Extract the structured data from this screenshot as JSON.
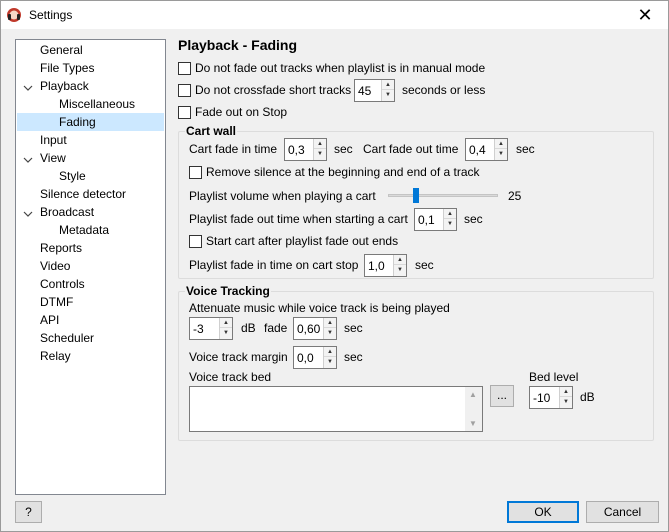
{
  "window": {
    "title": "Settings",
    "close_glyph": "✕"
  },
  "icons": {
    "app": "app-icon",
    "close": "close-icon",
    "chevron": "chevron-down-icon"
  },
  "tree": {
    "items": [
      {
        "label": "General",
        "expanded": false
      },
      {
        "label": "File Types",
        "expanded": false
      },
      {
        "label": "Playback",
        "expanded": true
      },
      {
        "label": "Miscellaneous",
        "expanded": false
      },
      {
        "label": "Fading",
        "selected": true
      },
      {
        "label": "Input",
        "expanded": false
      },
      {
        "label": "View",
        "expanded": true
      },
      {
        "label": "Style",
        "expanded": false
      },
      {
        "label": "Silence detector",
        "expanded": false
      },
      {
        "label": "Broadcast",
        "expanded": true
      },
      {
        "label": "Metadata",
        "expanded": false
      },
      {
        "label": "Reports",
        "expanded": false
      },
      {
        "label": "Video",
        "expanded": false
      },
      {
        "label": "Controls",
        "expanded": false
      },
      {
        "label": "DTMF",
        "expanded": false
      },
      {
        "label": "API",
        "expanded": false
      },
      {
        "label": "Scheduler",
        "expanded": false
      },
      {
        "label": "Relay",
        "expanded": false
      }
    ]
  },
  "page": {
    "heading": "Playback - Fading",
    "no_fade_manual": "Do not fade out tracks when playlist is in manual mode",
    "no_crossfade_short": "Do not crossfade short tracks",
    "crossfade_seconds": "45",
    "seconds_or_less": "seconds or less",
    "fade_out_on_stop": "Fade out on Stop"
  },
  "cart_wall": {
    "title": "Cart wall",
    "fade_in_label": "Cart fade in time",
    "fade_in_value": "0,3",
    "fade_out_label": "Cart fade out time",
    "fade_out_value": "0,4",
    "sec": "sec",
    "remove_silence": "Remove silence at the beginning and end of a track",
    "playlist_volume_label": "Playlist volume when playing a cart",
    "playlist_volume_value": "25",
    "playlist_volume_fraction": 0.25,
    "playlist_fade_out_label": "Playlist fade out time when starting a cart",
    "playlist_fade_out_value": "0,1",
    "start_after_fade": "Start cart after playlist fade out ends",
    "playlist_fade_in_label": "Playlist fade in time on cart stop",
    "playlist_fade_in_value": "1,0"
  },
  "voice_tracking": {
    "title": "Voice Tracking",
    "attenuate_label": "Attenuate music while voice track is being played",
    "attenuate_value": "-3",
    "db": "dB",
    "fade_label": "fade",
    "fade_value": "0,60",
    "sec": "sec",
    "margin_label": "Voice track margin",
    "margin_value": "0,0",
    "bed_label": "Voice track bed",
    "browse": "...",
    "bed_level_label": "Bed level",
    "bed_level_value": "-10"
  },
  "footer": {
    "help": "?",
    "ok": "OK",
    "cancel": "Cancel"
  }
}
